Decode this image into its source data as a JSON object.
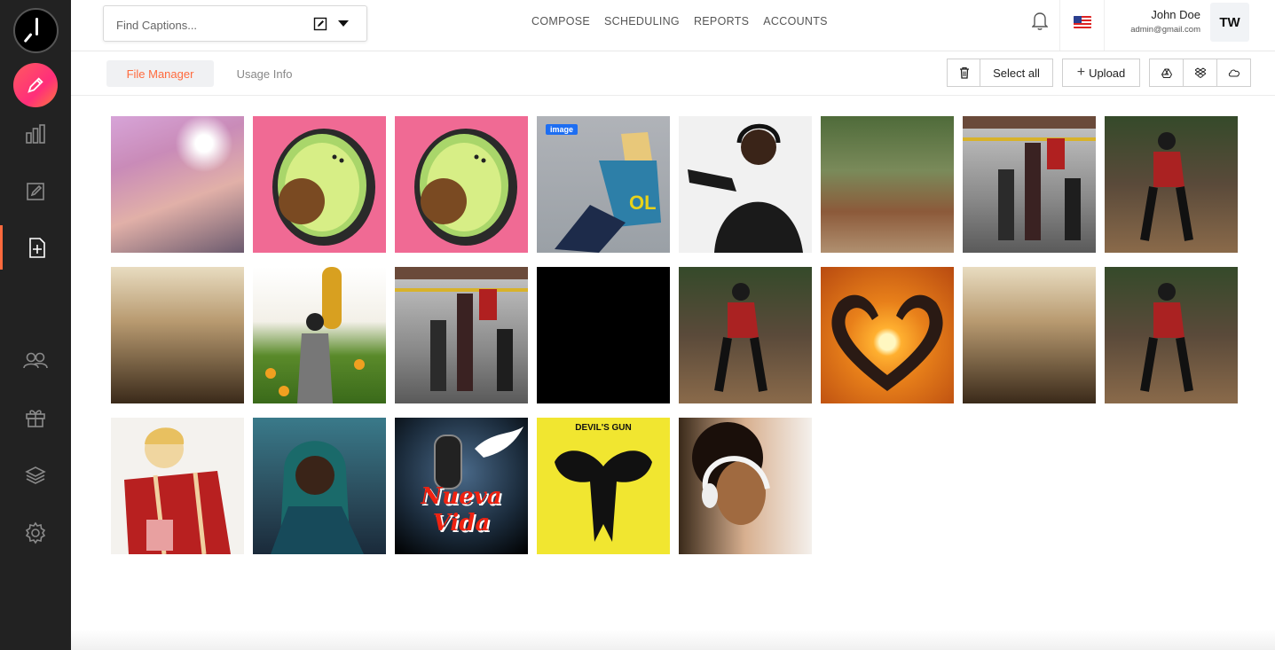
{
  "search": {
    "placeholder": "Find Captions..."
  },
  "nav": [
    "COMPOSE",
    "SCHEDULING",
    "REPORTS",
    "ACCOUNTS"
  ],
  "user": {
    "name": "John Doe",
    "email": "admin@gmail.com",
    "initials": "TW"
  },
  "tabs": {
    "active": "File Manager",
    "inactive": "Usage Info"
  },
  "toolbar": {
    "select_all": "Select all",
    "upload": "Upload",
    "upload_icon": "+"
  },
  "media": {
    "badge_label": "image",
    "tile4_caption_top": "DEVIL'S GUN",
    "tile3_caption": "Nueva Vida"
  },
  "colors": {
    "sidebar": "#222222",
    "accent": "#ff6a3d",
    "badge": "#1d6ef2"
  }
}
